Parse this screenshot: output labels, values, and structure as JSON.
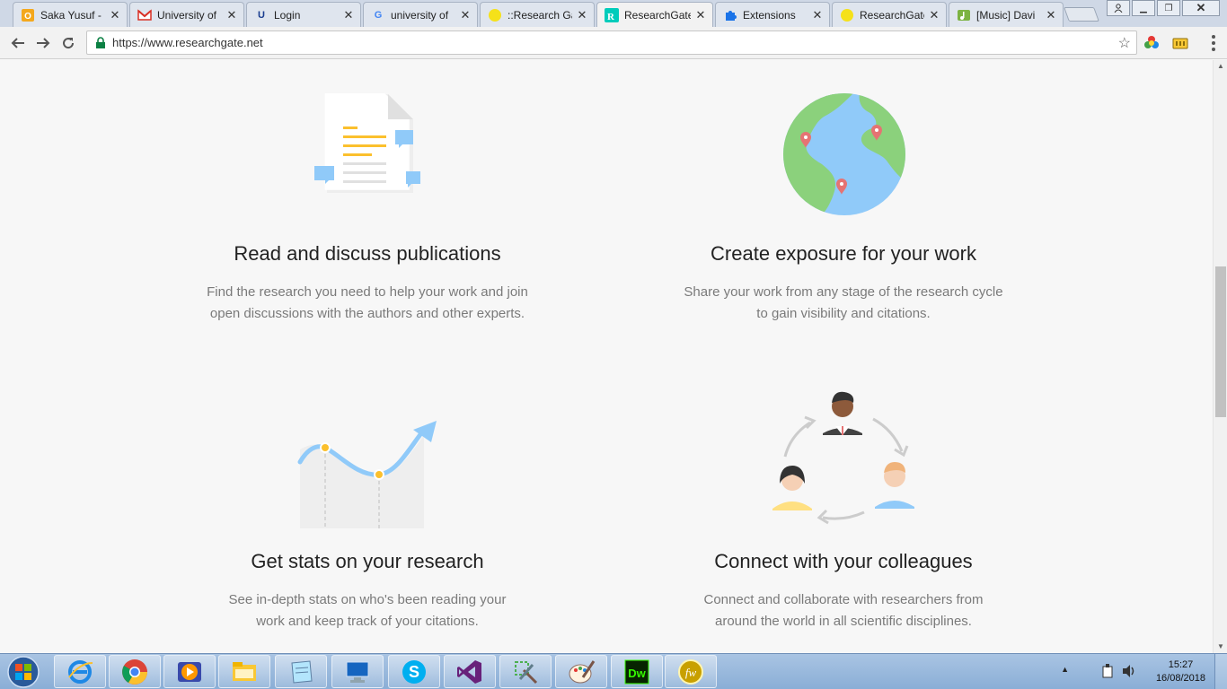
{
  "browser": {
    "tabs": [
      {
        "title": "Saka Yusuf - ",
        "icon": "outlook-icon",
        "color": "#f4a81d"
      },
      {
        "title": "University of",
        "icon": "gmail-icon",
        "color": "#d93025"
      },
      {
        "title": "Login",
        "icon": "ub-icon",
        "color": "#1a3d8f"
      },
      {
        "title": "university of",
        "icon": "google-icon",
        "color": "#4285f4"
      },
      {
        "title": "::Research Ga",
        "icon": "yellow-circle-icon",
        "color": "#f5e11a"
      },
      {
        "title": "ResearchGate",
        "icon": "researchgate-icon",
        "color": "#00ccbb"
      },
      {
        "title": "Extensions",
        "icon": "puzzle-icon",
        "color": "#1a73e8"
      },
      {
        "title": "ResearchGate",
        "icon": "yellow-circle-icon",
        "color": "#f5e11a"
      },
      {
        "title": "[Music] Davi",
        "icon": "music-icon",
        "color": "#7cb342"
      }
    ],
    "active_tab_index": 5,
    "url": "https://www.researchgate.net"
  },
  "features": [
    {
      "title": "Read and discuss publications",
      "description": "Find the research you need to help your work and join open discussions with the authors and other experts.",
      "icon": "publications-icon"
    },
    {
      "title": "Create exposure for your work",
      "description": "Share your work from any stage of the research cycle to gain visibility and citations.",
      "icon": "globe-icon"
    },
    {
      "title": "Get stats on your research",
      "description": "See in-depth stats on who's been reading your work and keep track of your citations.",
      "icon": "stats-chart-icon"
    },
    {
      "title": "Connect with your colleagues",
      "description": "Connect and collaborate with researchers from around the world in all scientific disciplines.",
      "icon": "colleagues-icon"
    }
  ],
  "taskbar": {
    "apps": [
      "internet-explorer-icon",
      "chrome-icon",
      "media-player-icon",
      "file-explorer-icon",
      "notepad-icon",
      "remote-desktop-icon",
      "skype-icon",
      "visual-studio-icon",
      "toolbox-icon",
      "paint-icon",
      "dreamweaver-icon",
      "app-icon"
    ],
    "time": "15:27",
    "date": "16/08/2018"
  },
  "colors": {
    "accent_blue": "#90caf9",
    "accent_yellow": "#fbc02d",
    "page_bg": "#f7f7f7",
    "map_green": "#8bd17c",
    "pin_red": "#e57373"
  }
}
